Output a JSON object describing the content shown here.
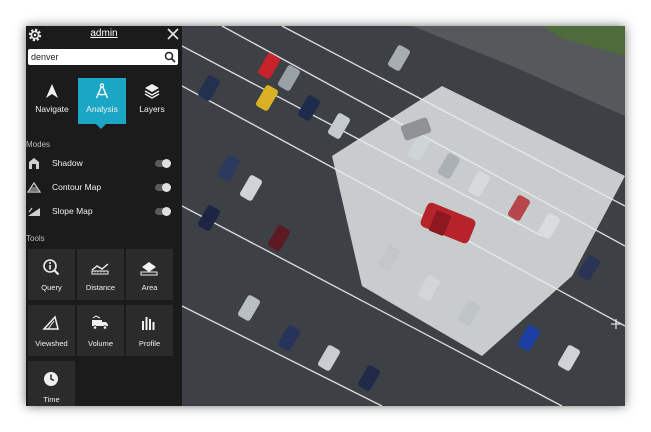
{
  "header": {
    "username": "admin"
  },
  "search": {
    "value": "denver"
  },
  "tabs": [
    {
      "label": "Navigate",
      "icon": "navigate-arrow-icon",
      "active": false
    },
    {
      "label": "Analysis",
      "icon": "compass-icon",
      "active": true
    },
    {
      "label": "Layers",
      "icon": "layers-stack-icon",
      "active": false
    }
  ],
  "modes": {
    "heading": "Modes",
    "items": [
      {
        "label": "Shadow",
        "icon": "shadow-icon",
        "enabled": false
      },
      {
        "label": "Contour Map",
        "icon": "contour-icon",
        "enabled": false
      },
      {
        "label": "Slope Map",
        "icon": "slope-icon",
        "enabled": false
      }
    ]
  },
  "tools": {
    "heading": "Tools",
    "items": [
      {
        "label": "Query",
        "icon": "query-info-icon"
      },
      {
        "label": "Distance",
        "icon": "ruler-icon"
      },
      {
        "label": "Area",
        "icon": "area-icon"
      },
      {
        "label": "Viewshed",
        "icon": "viewshed-icon"
      },
      {
        "label": "Volume",
        "icon": "truck-volume-icon"
      },
      {
        "label": "Profile",
        "icon": "profile-bars-icon"
      },
      {
        "label": "Time",
        "icon": "clock-icon"
      }
    ]
  },
  "colors": {
    "accent": "#1aa6c4",
    "panel": "#1b1b1b",
    "tile": "#2b2b2b"
  }
}
